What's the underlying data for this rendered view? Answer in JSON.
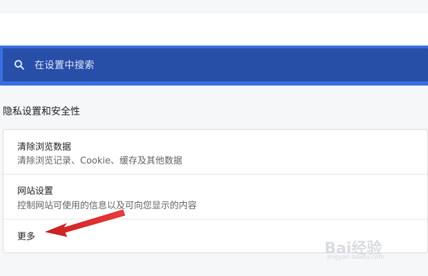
{
  "search": {
    "placeholder": "在设置中搜索"
  },
  "section": {
    "title": "隐私设置和安全性"
  },
  "items": [
    {
      "title": "清除浏览数据",
      "subtitle": "清除浏览记录、Cookie、缓存及其他数据"
    },
    {
      "title": "网站设置",
      "subtitle": "控制网站可使用的信息以及可向您显示的内容"
    },
    {
      "title": "更多"
    }
  ],
  "watermark": {
    "brand": "Bai经验",
    "url": "jingyan.baidu.com"
  },
  "colors": {
    "search_outer": "#3b6ee0",
    "search_bar": "#284fa8",
    "arrow": "#e32b2b"
  }
}
